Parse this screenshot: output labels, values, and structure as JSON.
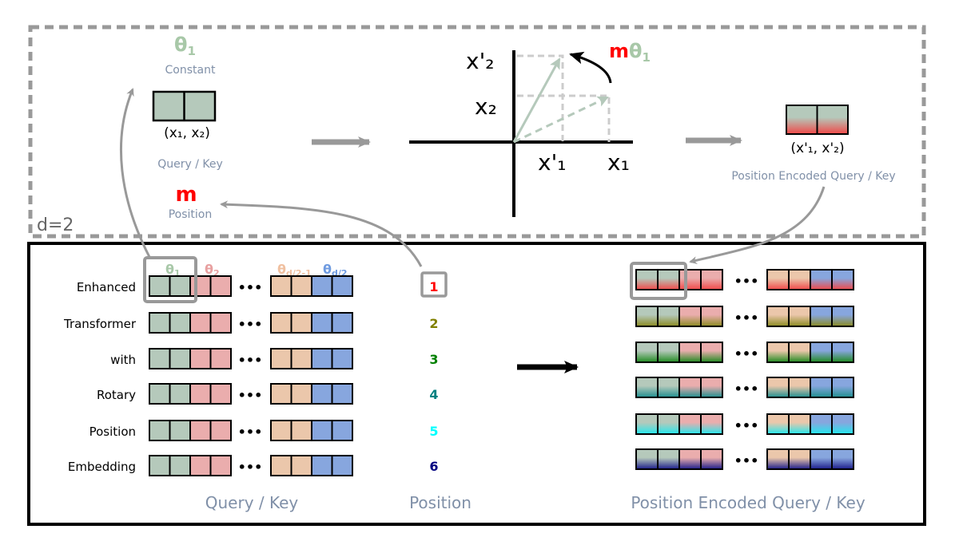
{
  "colors": {
    "theta1": "#a8c8a8",
    "theta2": "#e8a0a0",
    "theta_d2m1": "#f0c0a0",
    "theta_d2": "#6f9be0",
    "muted_label": "#8090a8",
    "position_m": "#ff0000",
    "cell_green": "#b5c9bb",
    "cell_red": "#eaadad",
    "cell_peach": "#ebc7ab",
    "cell_blue": "#87a6de",
    "arrow_gray": "#999999",
    "dashed_border": "#999999"
  },
  "top_panel": {
    "dimension_label": "d=2",
    "theta_symbol": "θ",
    "theta_subscript": "1",
    "constant_label": "Constant",
    "input_vector_label": "(x₁, x₂)",
    "query_key_label": "Query / Key",
    "m_symbol": "m",
    "position_label": "Position",
    "rotation": {
      "x1_label": "x₁",
      "x2_label": "x₂",
      "x1_prime_label": "x'₁",
      "x2_prime_label": "x'₂",
      "angle_m": "m",
      "angle_theta": "θ",
      "angle_sub": "1"
    },
    "output_vector_label": "(x'₁, x'₂)",
    "output_label": "Position Encoded Query / Key"
  },
  "bottom_panel": {
    "header_thetas": [
      {
        "symbol": "θ",
        "sub": "1"
      },
      {
        "symbol": "θ",
        "sub": "2"
      },
      {
        "symbol": "θ",
        "sub": "d/2-1"
      },
      {
        "symbol": "θ",
        "sub": "d/2"
      }
    ],
    "tokens": [
      {
        "word": "Enhanced",
        "position": "1",
        "pos_color": "#ff0000"
      },
      {
        "word": "Transformer",
        "position": "2",
        "pos_color": "#808000"
      },
      {
        "word": "with",
        "position": "3",
        "pos_color": "#008000"
      },
      {
        "word": "Rotary",
        "position": "4",
        "pos_color": "#008080"
      },
      {
        "word": "Position",
        "position": "5",
        "pos_color": "#00ffff"
      },
      {
        "word": "Embedding",
        "position": "6",
        "pos_color": "#000080"
      }
    ],
    "ellipsis": "•••",
    "query_key_caption": "Query / Key",
    "position_caption": "Position",
    "encoded_caption": "Position Encoded Query / Key"
  }
}
